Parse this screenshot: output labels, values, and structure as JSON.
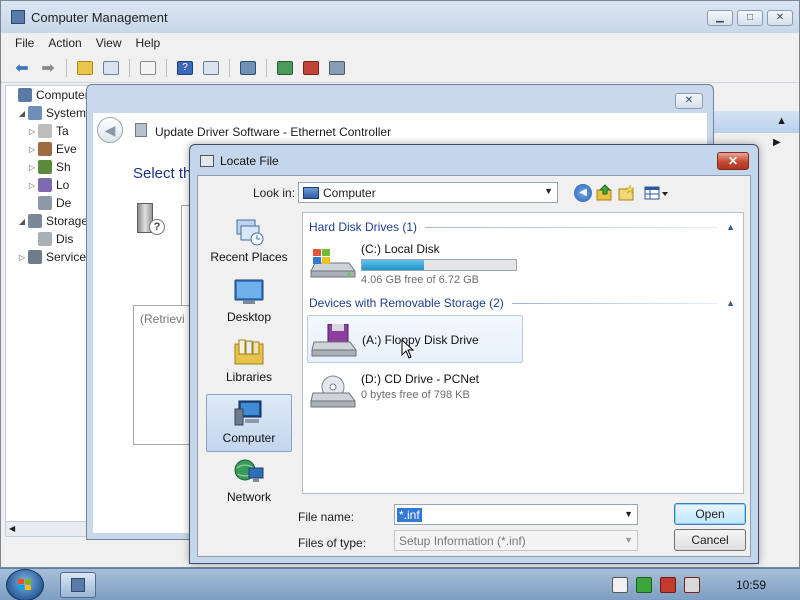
{
  "cm": {
    "title": "Computer Management",
    "menu": [
      "File",
      "Action",
      "View",
      "Help"
    ],
    "tree": [
      {
        "label": "Computer",
        "exp": "",
        "indent": 0
      },
      {
        "label": "System",
        "exp": "◢",
        "indent": 1
      },
      {
        "label": "Ta",
        "exp": "▷",
        "indent": 2
      },
      {
        "label": "Eve",
        "exp": "▷",
        "indent": 2
      },
      {
        "label": "Sh",
        "exp": "▷",
        "indent": 2
      },
      {
        "label": "Lo",
        "exp": "▷",
        "indent": 2
      },
      {
        "label": "De",
        "exp": "",
        "indent": 2
      },
      {
        "label": "Storage",
        "exp": "◢",
        "indent": 1
      },
      {
        "label": "Dis",
        "exp": "",
        "indent": 2
      },
      {
        "label": "Service",
        "exp": "▷",
        "indent": 1
      }
    ]
  },
  "ud": {
    "title": "Update Driver Software - Ethernet Controller",
    "heading": "Select th",
    "retrieving": "(Retrievi"
  },
  "lf": {
    "title": "Locate File",
    "look_in_label": "Look in:",
    "look_in_value": "Computer",
    "places": [
      {
        "label": "Recent Places",
        "icon": "recent-places-icon"
      },
      {
        "label": "Desktop",
        "icon": "desktop-icon"
      },
      {
        "label": "Libraries",
        "icon": "libraries-icon"
      },
      {
        "label": "Computer",
        "icon": "computer-icon",
        "selected": true
      },
      {
        "label": "Network",
        "icon": "network-icon"
      }
    ],
    "groups": {
      "hdd": "Hard Disk Drives (1)",
      "removable": "Devices with Removable Storage (2)"
    },
    "items": {
      "c": {
        "name": "(C:) Local Disk",
        "sub": "4.06 GB free of 6.72 GB",
        "used_fraction": 0.4
      },
      "a": {
        "name": "(A:) Floppy Disk Drive"
      },
      "d": {
        "name": "(D:) CD Drive - PCNet",
        "sub": "0 bytes free of 798 KB"
      }
    },
    "file_name_label": "File name:",
    "file_name_value": "*.inf",
    "files_of_type_label": "Files of type:",
    "files_of_type_value": "Setup Information (*.inf)",
    "open_label": "Open",
    "cancel_label": "Cancel"
  },
  "taskbar": {
    "clock": "10:59"
  }
}
